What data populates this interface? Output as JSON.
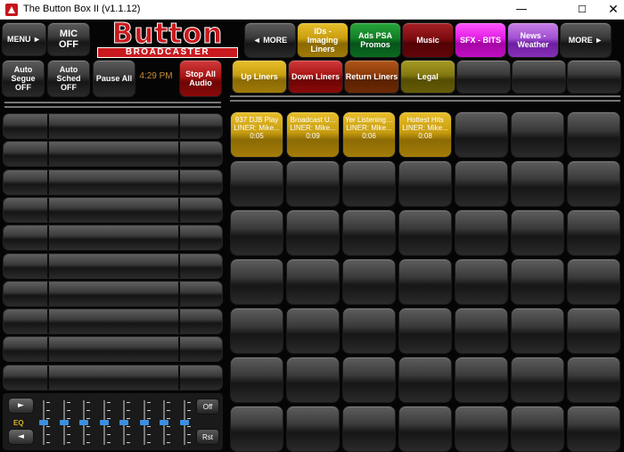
{
  "window": {
    "title": "The Button Box II (v1.1.12)",
    "minimize": "—",
    "maximize": "☐",
    "close": "✕"
  },
  "top": {
    "menu_label": "MENU ►",
    "mic_label": "MIC\nOFF",
    "logo_word": "Button",
    "logo_sub": "BROADCASTER",
    "more_left": "◄ MORE",
    "more_right": "MORE ►",
    "categories": [
      {
        "label": "IDs -\nImaging\nLiners",
        "color": "#c99e10"
      },
      {
        "label": "Ads  PSA\nPromos",
        "color": "#118025"
      },
      {
        "label": "Music",
        "color": "#7f0c10"
      },
      {
        "label": "SFX - BITS",
        "color": "#e21ee2"
      },
      {
        "label": "News -\nWeather",
        "color": "#a24fd2"
      }
    ]
  },
  "controls": {
    "auto_segue": "Auto\nSegue\nOFF",
    "auto_sched": "Auto\nSched\nOFF",
    "pause_all": "Pause All",
    "clock": "4:29 PM",
    "stop_all": "Stop All\nAudio"
  },
  "subtabs": [
    {
      "label": "Up Liners",
      "color": "#c99e10"
    },
    {
      "label": "Down Liners",
      "color": "#a81515"
    },
    {
      "label": "Return Liners",
      "color": "#8a3a08"
    },
    {
      "label": "Legal",
      "color": "#83780f"
    },
    {
      "label": ""
    },
    {
      "label": ""
    },
    {
      "label": ""
    }
  ],
  "carts": [
    {
      "title": "937 DJB Play",
      "type": "LINER: Mike...",
      "time": "0:05"
    },
    {
      "title": "Broadcast U...",
      "type": "LINER: Mike...",
      "time": "0:09"
    },
    {
      "title": "Yer Listening ...",
      "type": "LINER: Mike...",
      "time": "0:06"
    },
    {
      "title": "Hottest Hits",
      "type": "LINER: Mike...",
      "time": "0:08"
    }
  ],
  "eq": {
    "label": "EQ",
    "up_arrow": "►",
    "down_arrow": "◄",
    "off": "Off",
    "reset": "Rst",
    "band_levels": [
      0.5,
      0.5,
      0.5,
      0.5,
      0.5,
      0.5,
      0.5,
      0.5
    ]
  }
}
